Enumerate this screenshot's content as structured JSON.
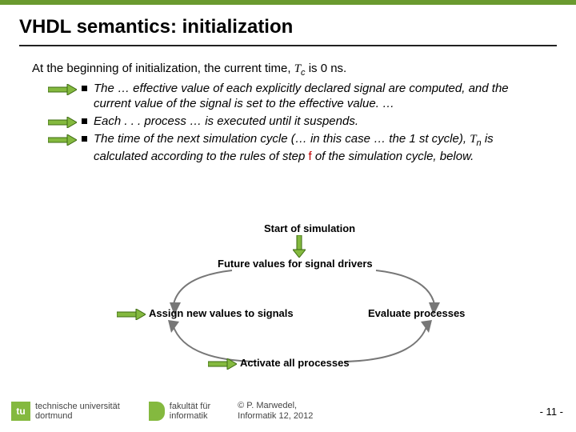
{
  "title": "VHDL semantics: initialization",
  "intro_pre": "At the beginning of initialization, the current time, ",
  "intro_tc": "T",
  "intro_tc_sub": "c",
  "intro_post": " is  0 ns.",
  "bullets": [
    "The … effective value of each explicitly declared signal are computed, and the current value of the signal is set to the effective value. …",
    "Each . . . process … is executed until it suspends."
  ],
  "bullet3_pre": "The time of the next simulation cycle (… in this case … the 1 st cycle), ",
  "bullet3_tn": "T",
  "bullet3_tn_sub": "n",
  "bullet3_mid": " is calculated according to the rules of step ",
  "bullet3_f": "f",
  "bullet3_post": " of the simulation cycle, below.",
  "diagram": {
    "start": "Start of simulation",
    "future": "Future values for signal drivers",
    "assign": "Assign new values to signals",
    "evaluate": "Evaluate processes",
    "activate": "Activate all processes"
  },
  "footer": {
    "uni1": "technische universität",
    "uni2": "dortmund",
    "fak1": "fakultät für",
    "fak2": "informatik",
    "copy1": "©  P. Marwedel,",
    "copy2": "Informatik 12,  2012",
    "page": "-  11 -"
  }
}
